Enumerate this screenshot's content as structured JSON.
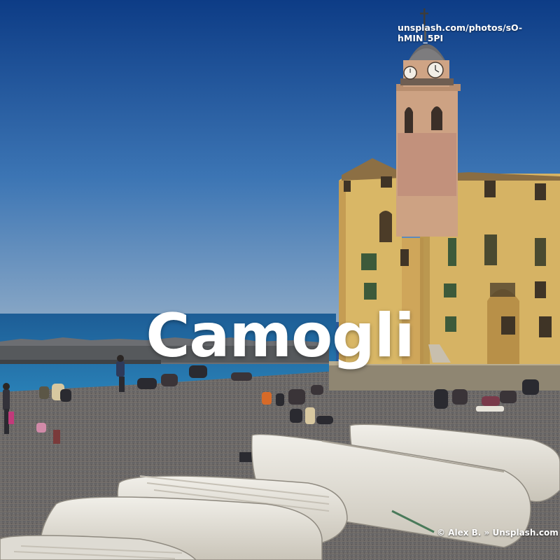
{
  "photo": {
    "title": "Camogli",
    "source_url": "unsplash.com/photos/sO-hMIN_5PI",
    "credit": "© Alex B. » Unsplash.com"
  },
  "colors": {
    "sky_top": "#0e3f88",
    "sky_bottom": "#7d9fc0",
    "sea": "#1f6aa6",
    "building": "#d9b667",
    "tower": "#c99a7e",
    "pebbles": "#6d6a68",
    "boats": "#e6e3dc"
  },
  "icons": [
    "clock-icon",
    "cross-icon"
  ]
}
